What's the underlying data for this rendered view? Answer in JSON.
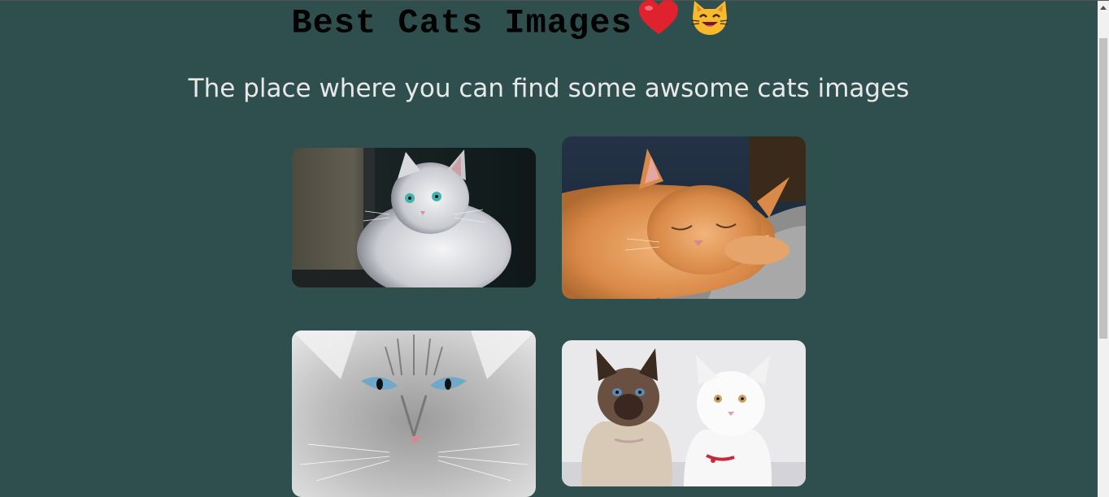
{
  "header": {
    "title": "Best Cats Images",
    "heart_icon": "heart-emoji",
    "cat_icon": "grinning-cat-emoji"
  },
  "subtitle": "The place where you can find some awsome cats images",
  "gallery": [
    {
      "name": "white-fluffy-cat-window"
    },
    {
      "name": "orange-sleeping-cat"
    },
    {
      "name": "grey-cat-blue-eyes-closeup"
    },
    {
      "name": "siamese-and-white-cats"
    }
  ],
  "colors": {
    "background": "#2f4f4f",
    "title": "#000000",
    "subtitle": "#e8e8e8"
  }
}
